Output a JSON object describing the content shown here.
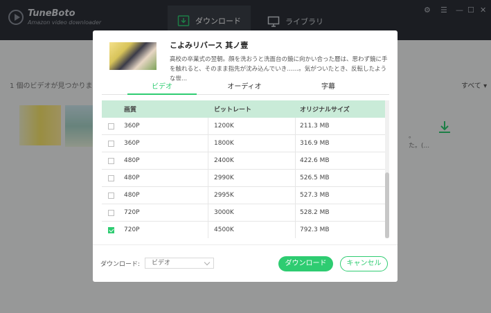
{
  "app": {
    "name": "TuneBoto",
    "subtitle": "Amazon video downloader"
  },
  "nav": {
    "tabs": [
      {
        "label": "ダウンロード"
      },
      {
        "label": "ライブラリ"
      }
    ]
  },
  "background": {
    "count_text": "1 個のビデオが見つかりま",
    "filter_label": "すべて ▾",
    "item_text_line1": "。",
    "item_text_line2": "た。(..."
  },
  "modal": {
    "title": "こよみリバース 其ノ壹",
    "description": "高校の卒業式の翌朝。顔を洗おうと洗面台の鏡に向かい合った暦は、思わず鏡に手を触れると、そのまま指先が沈み込んでいき……。気がついたとき、反転したような世...",
    "tabs": [
      {
        "label": "ビデオ"
      },
      {
        "label": "オーディオ"
      },
      {
        "label": "字幕"
      }
    ],
    "table": {
      "headers": [
        "画質",
        "ビットレート",
        "オリジナルサイズ"
      ],
      "rows": [
        {
          "quality": "360P",
          "bitrate": "1200K",
          "size": "211.3 MB",
          "checked": false
        },
        {
          "quality": "360P",
          "bitrate": "1800K",
          "size": "316.9 MB",
          "checked": false
        },
        {
          "quality": "480P",
          "bitrate": "2400K",
          "size": "422.6 MB",
          "checked": false
        },
        {
          "quality": "480P",
          "bitrate": "2990K",
          "size": "526.5 MB",
          "checked": false
        },
        {
          "quality": "480P",
          "bitrate": "2995K",
          "size": "527.3 MB",
          "checked": false
        },
        {
          "quality": "720P",
          "bitrate": "3000K",
          "size": "528.2 MB",
          "checked": false
        },
        {
          "quality": "720P",
          "bitrate": "4500K",
          "size": "792.3 MB",
          "checked": true
        }
      ]
    },
    "footer": {
      "download_label": "ダウンロード:",
      "select_value": "ビデオ",
      "download_button": "ダウンロード",
      "cancel_button": "キャンセル"
    }
  },
  "colors": {
    "accent": "#2ecc71",
    "titlebar": "#2c3038",
    "table_header": "#c9ebd8"
  }
}
